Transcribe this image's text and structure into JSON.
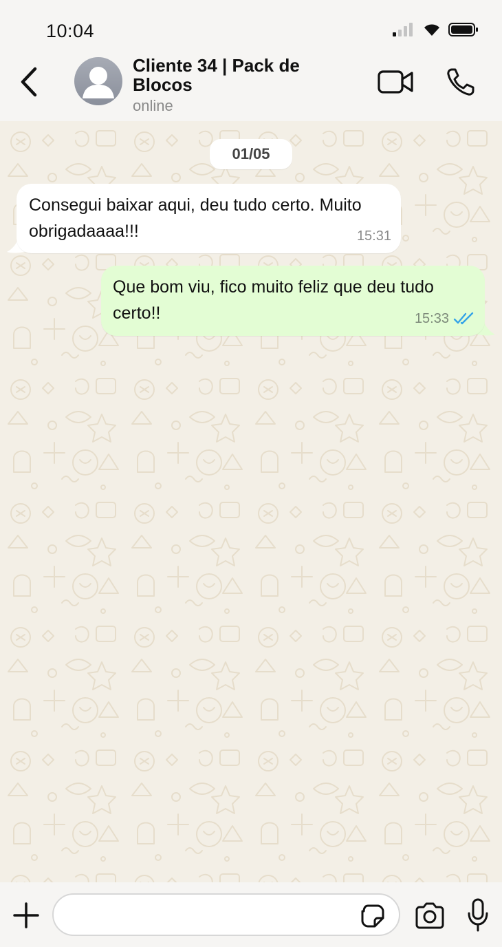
{
  "status_bar": {
    "time": "10:04",
    "icons": [
      "signal-icon",
      "wifi-icon",
      "battery-icon"
    ]
  },
  "header": {
    "contact_name": "Cliente 34 | Pack de Blocos",
    "contact_status": "online",
    "icons": [
      "back-arrow-icon",
      "avatar-icon",
      "video-call-icon",
      "phone-icon"
    ]
  },
  "chat": {
    "date_chip": "01/05",
    "messages": [
      {
        "direction": "incoming",
        "text": "Consegui baixar aqui, deu tudo certo. Muito obrigadaaaa!!!",
        "time": "15:31"
      },
      {
        "direction": "outgoing",
        "text": "Que bom viu, fico muito feliz que deu tudo certo!!",
        "time": "15:33",
        "status": "read"
      }
    ]
  },
  "input_bar": {
    "placeholder": "",
    "value": "",
    "icons": [
      "plus-icon",
      "sticker-icon",
      "camera-icon",
      "mic-icon"
    ]
  },
  "colors": {
    "outgoing_bubble": "#e3fdd4",
    "incoming_bubble": "#ffffff",
    "wallpaper": "#f3efe6",
    "read_ticks": "#34a3e8"
  }
}
